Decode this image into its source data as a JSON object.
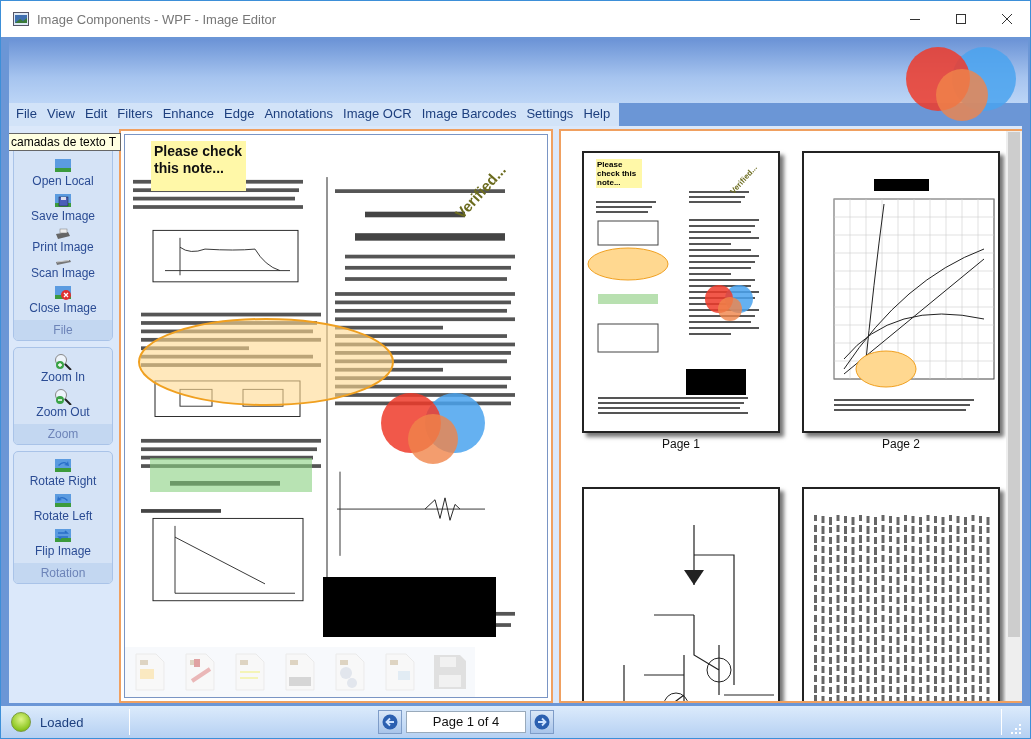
{
  "window": {
    "title": "Image Components - WPF - Image Editor"
  },
  "menu": [
    "File",
    "View",
    "Edit",
    "Filters",
    "Enhance",
    "Edge",
    "Annotations",
    "Image OCR",
    "Image Barcodes",
    "Settings",
    "Help"
  ],
  "tooltip": {
    "text": "camadas de texto T"
  },
  "sidebar": {
    "groups": [
      {
        "title": "File",
        "items": [
          {
            "label": "Open Local",
            "kind": "open"
          },
          {
            "label": "Save Image",
            "kind": "save"
          },
          {
            "label": "Print Image",
            "kind": "print"
          },
          {
            "label": "Scan Image",
            "kind": "scan"
          },
          {
            "label": "Close Image",
            "kind": "close"
          }
        ]
      },
      {
        "title": "Zoom",
        "items": [
          {
            "label": "Zoom In",
            "kind": "zoomin"
          },
          {
            "label": "Zoom Out",
            "kind": "zoomout"
          }
        ]
      },
      {
        "title": "Rotation",
        "items": [
          {
            "label": "Rotate Right",
            "kind": "rotright"
          },
          {
            "label": "Rotate Left",
            "kind": "rotleft"
          },
          {
            "label": "Flip Image",
            "kind": "flip"
          }
        ]
      }
    ]
  },
  "viewer": {
    "note": "Please check this note...",
    "stamp": "Verified..."
  },
  "thumbnails": [
    {
      "kind": "annotated",
      "label": "Page 1",
      "note": "Please check this note...",
      "stamp": "Verified..."
    },
    {
      "kind": "chart",
      "label": "Page 2"
    },
    {
      "kind": "circuit"
    },
    {
      "kind": "columns"
    }
  ],
  "status_bar": {
    "status": "Loaded",
    "page": "Page 1 of 4"
  }
}
